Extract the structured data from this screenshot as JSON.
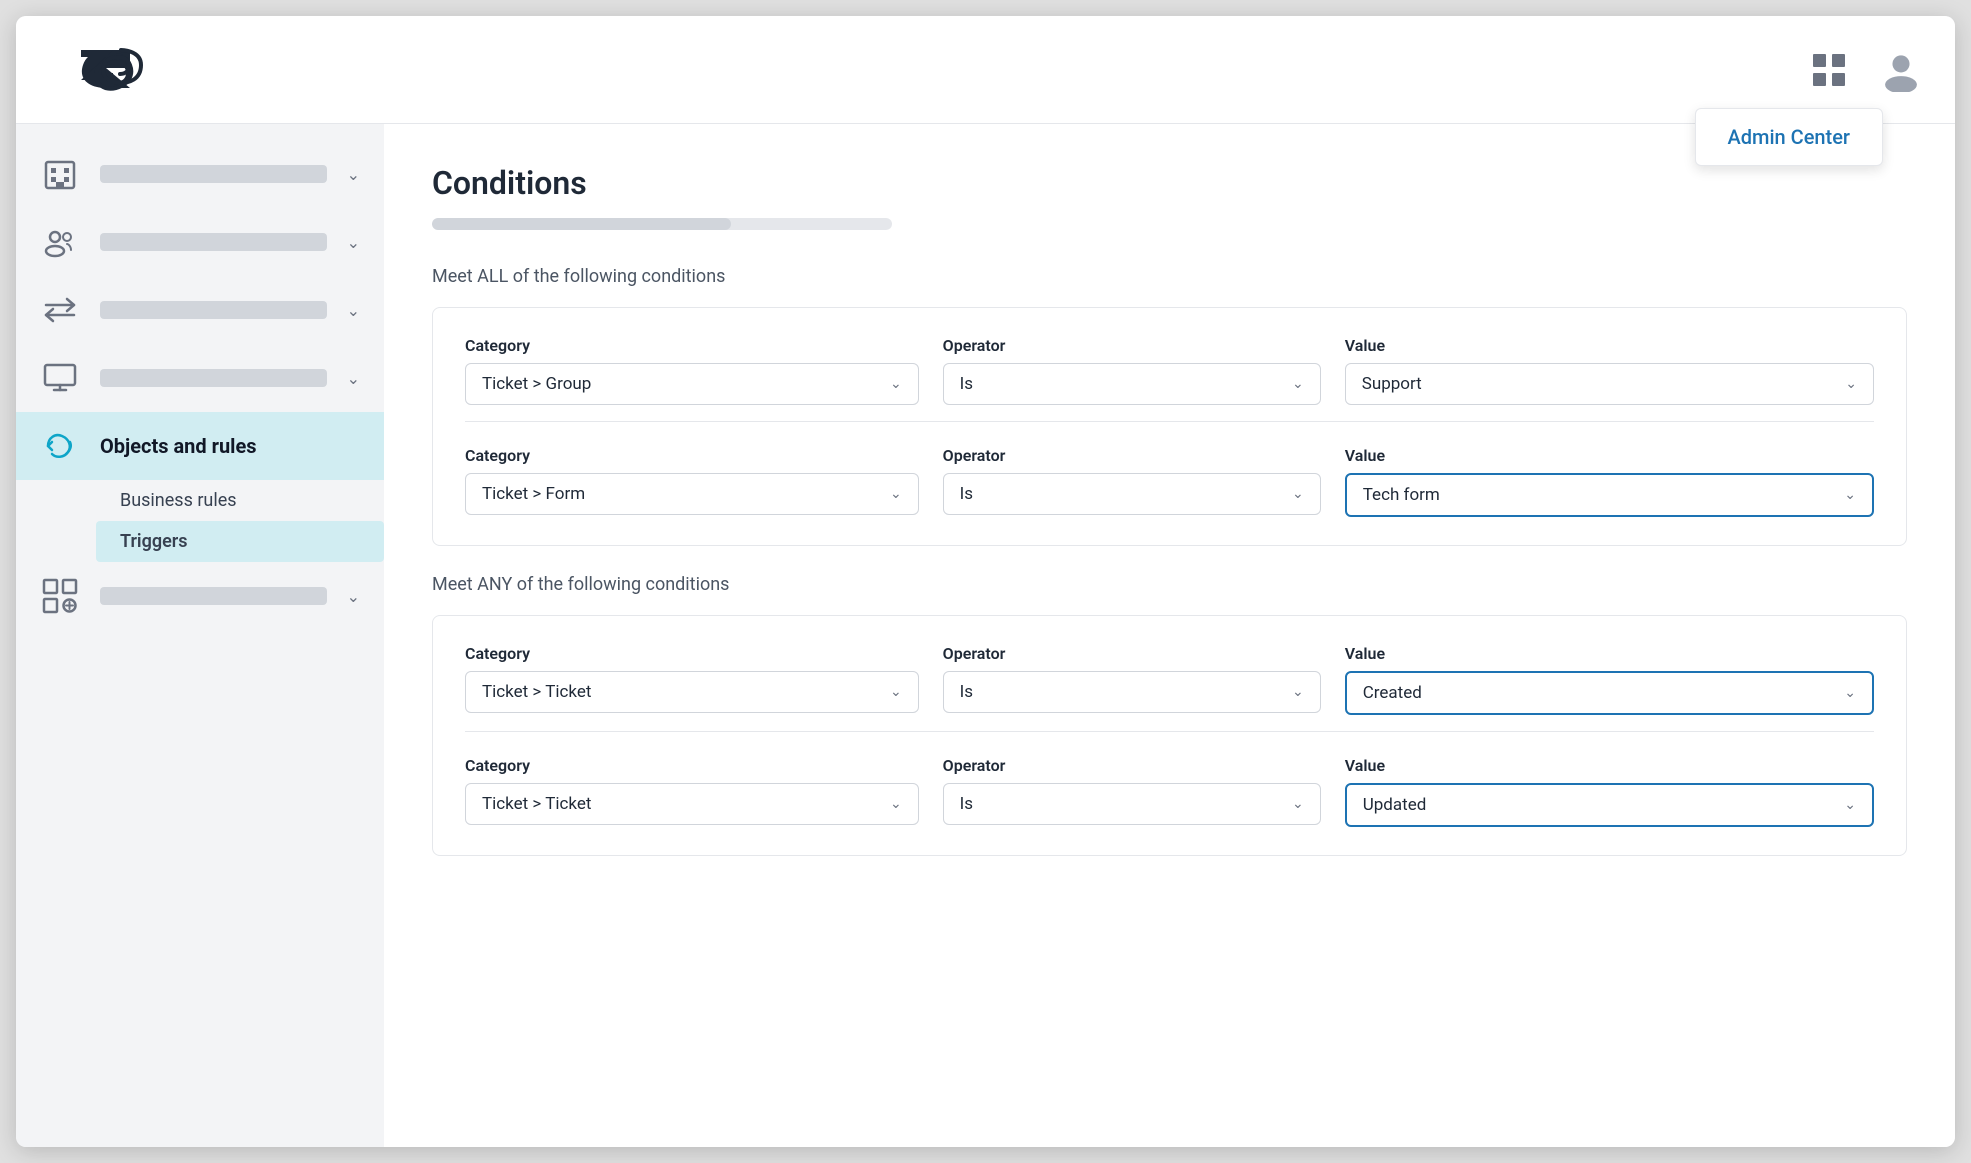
{
  "topbar": {
    "admin_center_label": "Admin Center"
  },
  "sidebar": {
    "items": [
      {
        "id": "org",
        "icon": "building-icon",
        "has_label": true,
        "has_chevron": true
      },
      {
        "id": "people",
        "icon": "people-icon",
        "has_label": true,
        "has_chevron": true
      },
      {
        "id": "arrows",
        "icon": "arrows-icon",
        "has_label": true,
        "has_chevron": true
      },
      {
        "id": "monitor",
        "icon": "monitor-icon",
        "has_label": true,
        "has_chevron": true
      },
      {
        "id": "objects",
        "icon": "objects-icon",
        "active": true,
        "text": "Objects and rules"
      },
      {
        "id": "addblock",
        "icon": "addblock-icon",
        "has_label": true,
        "has_chevron": true
      }
    ],
    "sub_items": [
      {
        "id": "business-rules",
        "label": "Business rules"
      },
      {
        "id": "triggers",
        "label": "Triggers",
        "active": true
      }
    ]
  },
  "content": {
    "title": "Conditions",
    "progress_pct": 65,
    "all_conditions_label": "Meet ALL of the following conditions",
    "any_conditions_label": "Meet ANY of the following conditions",
    "all_conditions": [
      {
        "category_label": "Category",
        "category_value": "Ticket > Group",
        "operator_label": "Operator",
        "operator_value": "Is",
        "value_label": "Value",
        "value_value": "Support",
        "value_highlighted": false
      },
      {
        "category_label": "Category",
        "category_value": "Ticket > Form",
        "operator_label": "Operator",
        "operator_value": "Is",
        "value_label": "Value",
        "value_value": "Tech form",
        "value_highlighted": true
      }
    ],
    "any_conditions": [
      {
        "category_label": "Category",
        "category_value": "Ticket > Ticket",
        "operator_label": "Operator",
        "operator_value": "Is",
        "value_label": "Value",
        "value_value": "Created",
        "value_highlighted": true
      },
      {
        "category_label": "Category",
        "category_value": "Ticket > Ticket",
        "operator_label": "Operator",
        "operator_value": "Is",
        "value_label": "Value",
        "value_value": "Updated",
        "value_highlighted": true
      }
    ]
  }
}
